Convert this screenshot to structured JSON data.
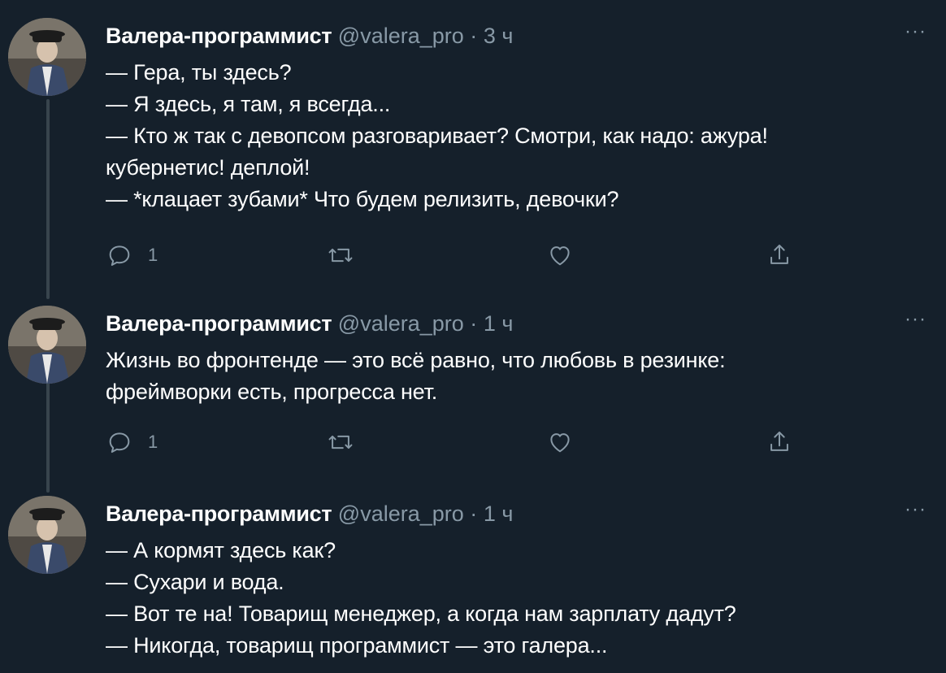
{
  "tweets": [
    {
      "display_name": "Валера-программист",
      "handle": "@valera_pro",
      "separator": "·",
      "time": "3 ч",
      "more_label": "···",
      "lines": [
        "— Гера, ты здесь?",
        "— Я здесь, я там, я всегда...",
        "— Кто ж так с девопсом разговаривает? Смотри, как надо: ажура!",
        "кубернетис! деплой!",
        "— *клацает зубами* Что будем релизить, девочки?"
      ],
      "reply_count": "1",
      "icons": [
        "reply-icon",
        "retweet-icon",
        "like-icon",
        "share-icon"
      ]
    },
    {
      "display_name": "Валера-программист",
      "handle": "@valera_pro",
      "separator": "·",
      "time": "1 ч",
      "more_label": "···",
      "lines": [
        "Жизнь во фронтенде — это всё равно, что любовь в резинке:",
        "фреймворки есть, прогресса нет."
      ],
      "reply_count": "1",
      "icons": [
        "reply-icon",
        "retweet-icon",
        "like-icon",
        "share-icon"
      ]
    },
    {
      "display_name": "Валера-программист",
      "handle": "@valera_pro",
      "separator": "·",
      "time": "1 ч",
      "more_label": "···",
      "lines": [
        "— А кормят здесь как?",
        "— Сухари и вода.",
        "— Вот те на! Товарищ менеджер, а когда нам зарплату дадут?",
        "— Никогда, товарищ программист — это галера..."
      ]
    }
  ],
  "colors": {
    "background": "#15202b",
    "text": "#ffffff",
    "secondary": "#8899a6",
    "thread_line": "#38444d"
  }
}
